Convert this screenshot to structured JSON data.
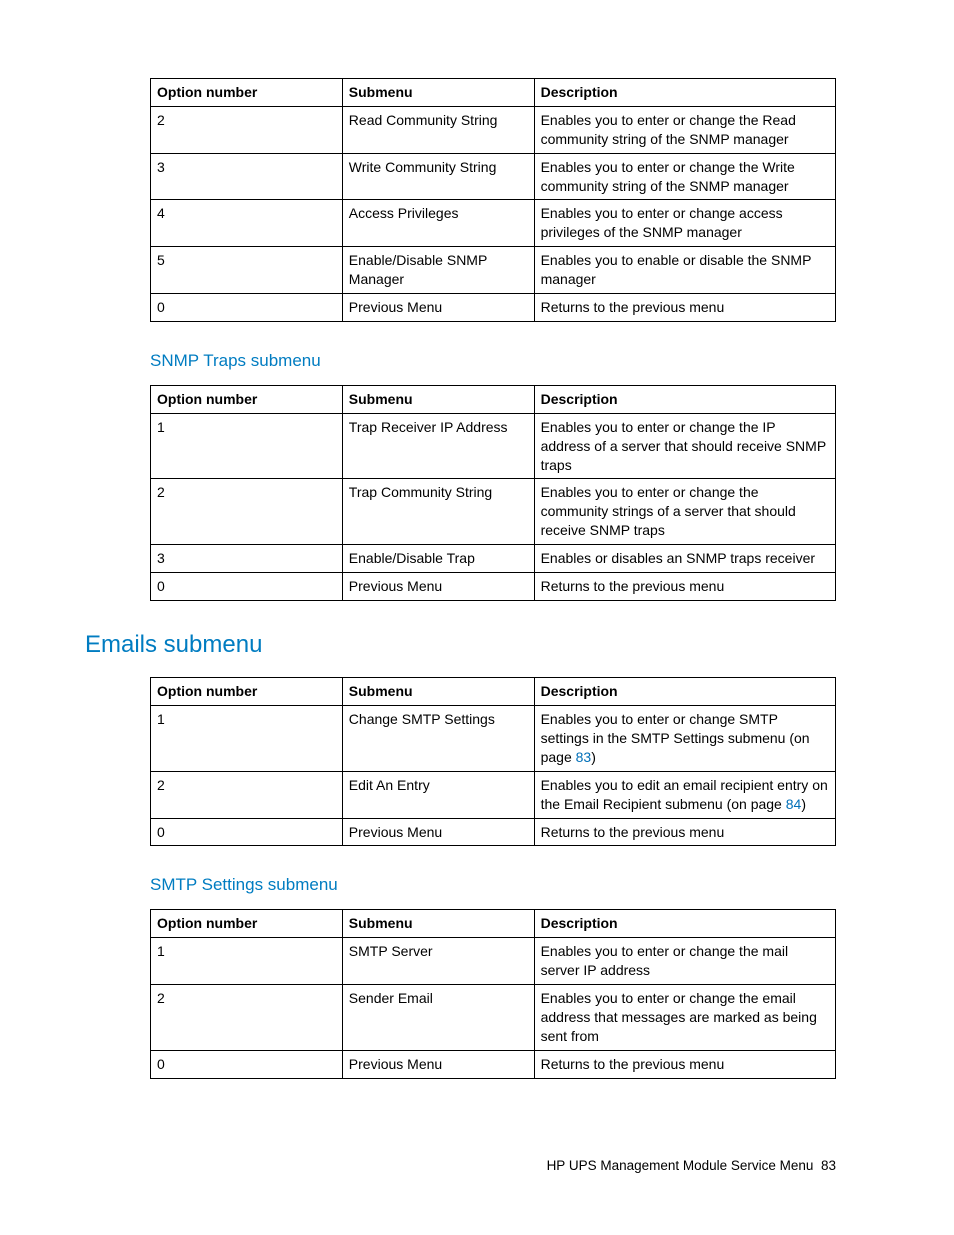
{
  "headers": {
    "option": "Option number",
    "submenu": "Submenu",
    "description": "Description"
  },
  "headings": {
    "snmp_traps": "SNMP Traps submenu",
    "emails": "Emails submenu",
    "smtp": "SMTP Settings submenu"
  },
  "table1": {
    "rows": [
      {
        "n": "2",
        "s": "Read Community String",
        "d": "Enables you to enter or change the Read community string of the SNMP manager"
      },
      {
        "n": "3",
        "s": "Write Community String",
        "d": "Enables you to enter or change the Write community string of the SNMP manager"
      },
      {
        "n": "4",
        "s": "Access Privileges",
        "d": "Enables you to enter or change access privileges of the SNMP manager"
      },
      {
        "n": "5",
        "s": "Enable/Disable SNMP Manager",
        "d": "Enables you to enable or disable the SNMP manager"
      },
      {
        "n": "0",
        "s": "Previous Menu",
        "d": "Returns to the previous menu"
      }
    ]
  },
  "table2": {
    "rows": [
      {
        "n": "1",
        "s": "Trap Receiver IP Address",
        "d": "Enables you to enter or change the IP address of a server that should receive SNMP traps"
      },
      {
        "n": "2",
        "s": "Trap Community String",
        "d": "Enables you to enter or change the community strings of a server that should receive SNMP traps"
      },
      {
        "n": "3",
        "s": "Enable/Disable Trap",
        "d": "Enables or disables an SNMP traps receiver"
      },
      {
        "n": "0",
        "s": "Previous Menu",
        "d": "Returns to the previous menu"
      }
    ]
  },
  "table3": {
    "rows": [
      {
        "n": "1",
        "s": "Change SMTP Settings",
        "d_pre": "Enables you to enter or change SMTP settings in the SMTP Settings submenu (on page ",
        "d_link": "83",
        "d_post": ")"
      },
      {
        "n": "2",
        "s": "Edit An Entry",
        "d_pre": "Enables you to edit an email recipient entry on the Email Recipient submenu (on page ",
        "d_link": "84",
        "d_post": ")"
      },
      {
        "n": "0",
        "s": "Previous Menu",
        "d": "Returns to the previous menu"
      }
    ]
  },
  "table4": {
    "rows": [
      {
        "n": "1",
        "s": "SMTP Server",
        "d": "Enables you to enter or change the mail server IP address"
      },
      {
        "n": "2",
        "s": "Sender Email",
        "d": "Enables you to enter or change the email address that messages are marked as being sent from"
      },
      {
        "n": "0",
        "s": "Previous Menu",
        "d": "Returns to the previous menu"
      }
    ]
  },
  "footer": {
    "text": "HP UPS Management Module Service Menu",
    "page": "83"
  }
}
